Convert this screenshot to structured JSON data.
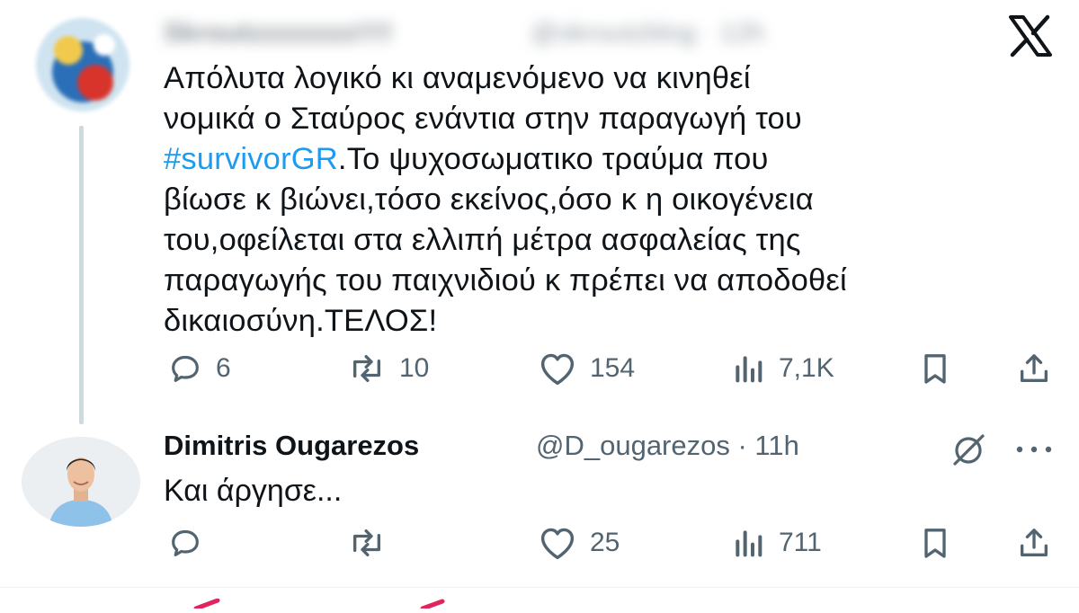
{
  "close": {
    "icon": "x-logo-icon"
  },
  "tweet1": {
    "blurred_name": "Skroutzzzzzzzz!!!!",
    "blurred_handle": "@skroutzblog · 12h",
    "text_lines": [
      "Απόλυτα λογικό κι αναμενόμενο να κινηθεί",
      "νομικά ο Σταύρος ενάντια στην παραγωγή του"
    ],
    "hashtag": "#survivorGR",
    "line3_rest": ".Το ψυχοσωματικο τραύμα που",
    "text_lines_after": [
      "βίωσε κ βιώνει,τόσο εκείνος,όσο κ η οικογένεια",
      "του,οφείλεται στα ελλιπή μέτρα ασφαλείας της",
      "παραγωγής του παιχνιδιού κ πρέπει να αποδοθεί",
      "δικαιοσύνη.ΤΕΛΟΣ!"
    ],
    "replies": "6",
    "retweets": "10",
    "likes": "154",
    "views": "7,1K"
  },
  "tweet2": {
    "name": "Dimitris Ougarezos",
    "handle": "@D_ougarezos · 11h",
    "text": "Και άργησε...",
    "replies": "",
    "retweets": "",
    "likes": "25",
    "views": "711"
  },
  "colors": {
    "accent": "#1d9bf0",
    "muted": "#536471",
    "text": "#0f1419",
    "red": "#e0245e"
  }
}
